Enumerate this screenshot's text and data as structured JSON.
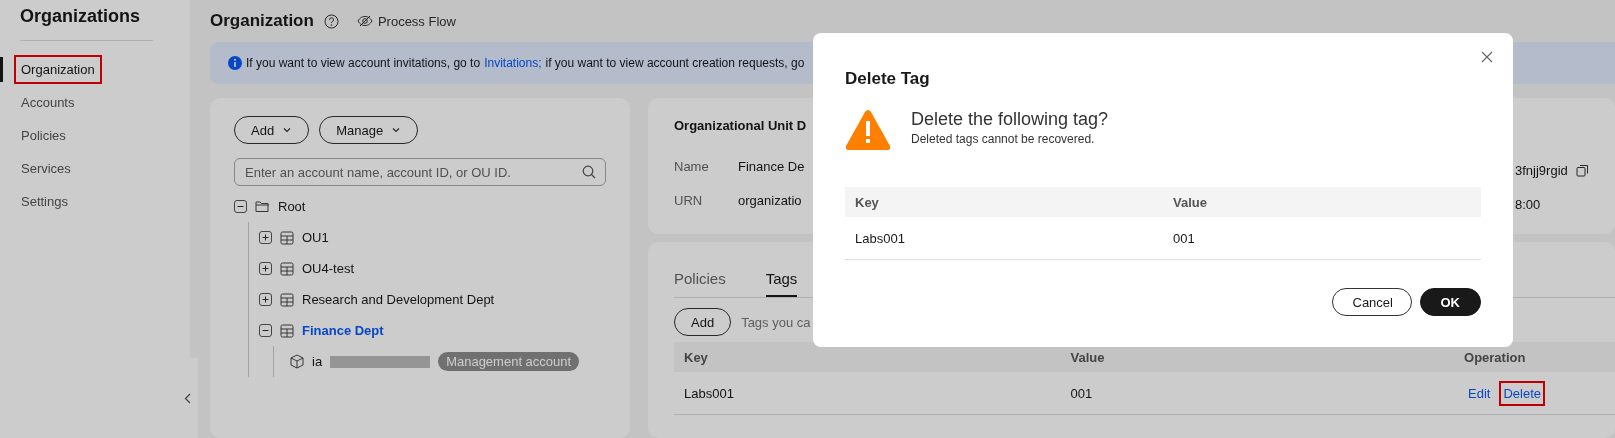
{
  "sidebar": {
    "title": "Organizations",
    "items": [
      {
        "label": "Organization",
        "selected": true,
        "highlighted": true
      },
      {
        "label": "Accounts",
        "selected": false,
        "highlighted": false
      },
      {
        "label": "Policies",
        "selected": false,
        "highlighted": false
      },
      {
        "label": "Services",
        "selected": false,
        "highlighted": false
      },
      {
        "label": "Settings",
        "selected": false,
        "highlighted": false
      }
    ]
  },
  "header": {
    "title": "Organization",
    "link": "Process Flow"
  },
  "banner": {
    "text_before": "If you want to view account invitations, go to",
    "link": "Invitations;",
    "text_after": "if you want to view account creation requests, go"
  },
  "tree_panel": {
    "buttons": [
      "Add",
      "Manage"
    ],
    "search": {
      "placeholder": "Enter an account name, account ID, or OU ID."
    },
    "tree": [
      {
        "kind": "root",
        "label": "Root",
        "expanded": true,
        "selected": false,
        "children": [
          {
            "kind": "ou",
            "label": "OU1",
            "expanded": false,
            "selected": false
          },
          {
            "kind": "ou",
            "label": "OU4-test",
            "expanded": false,
            "selected": false
          },
          {
            "kind": "ou",
            "label": "Research and Development Dept",
            "expanded": false,
            "selected": false
          },
          {
            "kind": "ou",
            "label": "Finance Dept",
            "expanded": true,
            "selected": true,
            "children": [
              {
                "kind": "account",
                "label": "ia",
                "badge": "Management account"
              }
            ]
          }
        ]
      }
    ]
  },
  "details": {
    "title": "Organizational Unit D",
    "fields": [
      {
        "label": "Name",
        "value": "Finance De"
      },
      {
        "label": "URN",
        "value": "organizatio"
      }
    ],
    "fields_right": [
      {
        "value": "3fnjj9rgid",
        "copy": true
      },
      {
        "value": "8:00",
        "copy": false
      }
    ]
  },
  "tags_panel": {
    "tabs": [
      {
        "label": "Policies",
        "selected": false
      },
      {
        "label": "Tags",
        "selected": true
      }
    ],
    "add_button": "Add",
    "hint": "Tags you ca",
    "table": {
      "columns": [
        "Key",
        "Value",
        "Operation"
      ],
      "rows": [
        {
          "key": "Labs001",
          "value": "001",
          "actions": [
            {
              "label": "Edit",
              "highlighted": false
            },
            {
              "label": "Delete",
              "highlighted": true
            }
          ]
        }
      ]
    }
  },
  "dialog": {
    "title": "Delete Tag",
    "heading": "Delete the following tag?",
    "message": "Deleted tags cannot be recovered.",
    "table": {
      "columns": [
        "Key",
        "Value"
      ],
      "rows": [
        [
          "Labs001",
          "001"
        ]
      ]
    },
    "buttons": [
      {
        "label": "Cancel",
        "kind": "secondary"
      },
      {
        "label": "OK",
        "kind": "primary"
      }
    ]
  }
}
